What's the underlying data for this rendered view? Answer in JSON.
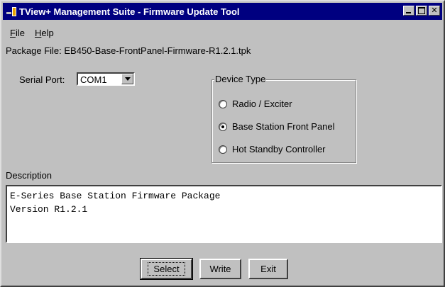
{
  "window": {
    "title": "TView+ Management Suite - Firmware Update Tool"
  },
  "menu": {
    "file": {
      "underlined": "F",
      "rest": "ile"
    },
    "help": {
      "underlined": "H",
      "rest": "elp"
    }
  },
  "package": {
    "label": "Package File:",
    "value": "EB450-Base-FrontPanel-Firmware-R1.2.1.tpk"
  },
  "serial_port": {
    "label": "Serial Port:",
    "selected": "COM1"
  },
  "device_type": {
    "legend": "Device Type",
    "options": [
      {
        "label": "Radio / Exciter",
        "checked": false
      },
      {
        "label": "Base Station Front Panel",
        "checked": true
      },
      {
        "label": "Hot Standby Controller",
        "checked": false
      }
    ]
  },
  "description": {
    "label": "Description",
    "lines": [
      "E-Series Base Station Firmware Package",
      "Version R1.2.1"
    ]
  },
  "buttons": {
    "select": "Select",
    "write": "Write",
    "exit": "Exit"
  },
  "icons": {
    "app": "app-icon",
    "minimize": "minimize-icon",
    "maximize": "maximize-icon",
    "close": "close-icon",
    "dropdown": "chevron-down-icon"
  },
  "colors": {
    "titlebar": "#000080",
    "face": "#c0c0c0"
  }
}
